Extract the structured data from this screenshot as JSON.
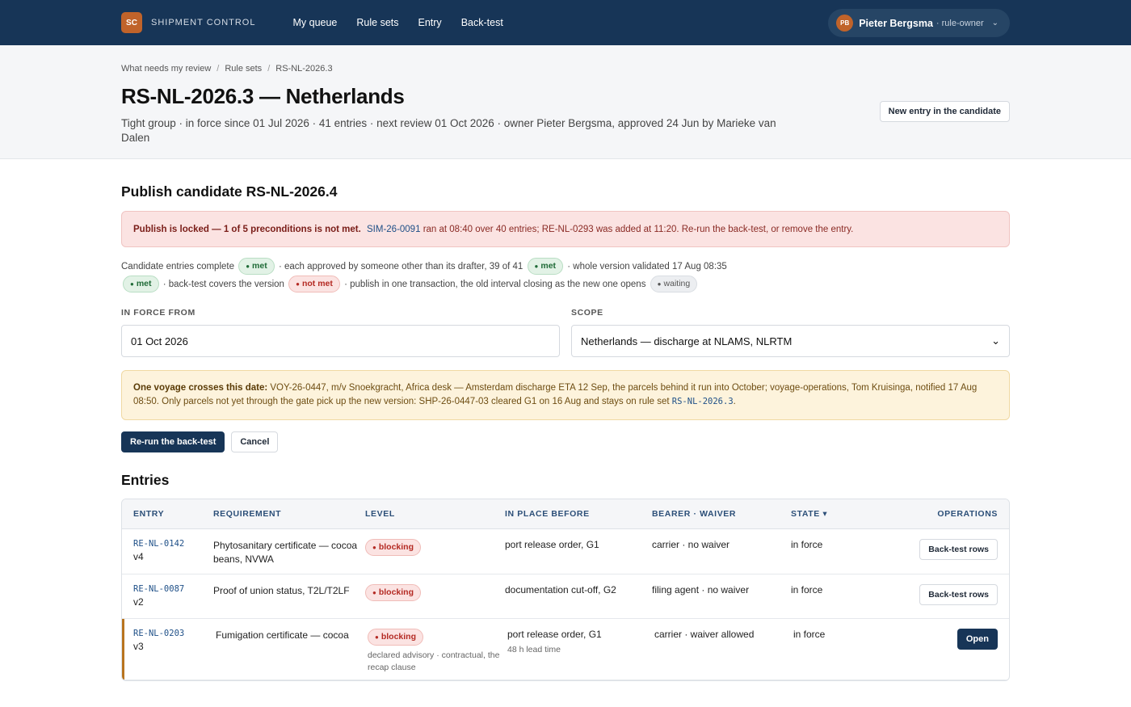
{
  "topbar": {
    "logo": "SC",
    "brand": "SHIPMENT CONTROL",
    "nav": [
      "My queue",
      "Rule sets",
      "Entry",
      "Back-test"
    ],
    "user": {
      "initials": "PB",
      "name": "Pieter Bergsma",
      "role": "· rule-owner"
    }
  },
  "breadcrumb": [
    "What needs my review",
    "Rule sets",
    "RS-NL-2026.3"
  ],
  "header": {
    "title": "RS-NL-2026.3 — Netherlands",
    "subtitle": "Tight group · in force since 01 Jul 2026 · 41 entries · next review 01 Oct 2026 · owner Pieter Bergsma, approved 24 Jun by Marieke van Dalen",
    "new_entry_button": "New entry in the candidate"
  },
  "publish": {
    "heading": "Publish candidate RS-NL-2026.4",
    "alert_bold": "Publish is locked — 1 of 5 preconditions is not met.",
    "alert_link": "SIM-26-0091",
    "alert_rest": "ran at 08:40 over 40 entries; RE-NL-0293 was added at 11:20. Re-run the back-test, or remove the entry.",
    "pre1": "Candidate entries complete",
    "pre2": "· each approved by someone other than its drafter, 39 of 41",
    "pre3": "· whole version validated 17 Aug 08:35",
    "pre4": "· back-test covers the version",
    "pre5": "· publish in one transaction, the old interval closing as the new one opens",
    "met": "met",
    "not_met": "not met",
    "waiting": "waiting"
  },
  "form": {
    "in_force_label": "IN FORCE FROM",
    "in_force_value": "01 Oct 2026",
    "scope_label": "SCOPE",
    "scope_value": "Netherlands — discharge at NLAMS, NLRTM"
  },
  "warning": {
    "bold": "One voyage crosses this date:",
    "text": "VOY-26-0447, m/v Snoekgracht, Africa desk — Amsterdam discharge ETA 12 Sep, the parcels behind it run into October; voyage-operations, Tom Kruisinga, notified 17 Aug 08:50. Only parcels not yet through the gate pick up the new version: SHP-26-0447-03 cleared G1 on 16 Aug and stays on rule set",
    "code": "RS-NL-2026.3",
    "end": "."
  },
  "actions": {
    "rerun": "Re-run the back-test",
    "cancel": "Cancel"
  },
  "entries": {
    "heading": "Entries",
    "columns": [
      "ENTRY",
      "REQUIREMENT",
      "LEVEL",
      "IN PLACE BEFORE",
      "BEARER · WAIVER",
      "STATE",
      "OPERATIONS"
    ],
    "rows": [
      {
        "id": "RE-NL-0142",
        "ver": "v4",
        "req": "Phytosanitary certificate — cocoa beans, NVWA",
        "level": "blocking",
        "note": "",
        "before": "port release order, G1",
        "before_sub": "",
        "bearer": "carrier · no waiver",
        "state": "in force",
        "op": "Back-test rows"
      },
      {
        "id": "RE-NL-0087",
        "ver": "v2",
        "req": "Proof of union status, T2L/T2LF",
        "level": "blocking",
        "note": "",
        "before": "documentation cut-off, G2",
        "before_sub": "",
        "bearer": "filing agent · no waiver",
        "state": "in force",
        "op": "Back-test rows"
      },
      {
        "id": "RE-NL-0203",
        "ver": "v3",
        "req": "Fumigation certificate — cocoa",
        "level": "blocking",
        "note": "declared advisory · contractual, the recap clause",
        "before": "port release order, G1",
        "before_sub": "48 h lead time",
        "bearer": "carrier · waiver allowed",
        "state": "in force",
        "op": "Open"
      }
    ]
  }
}
